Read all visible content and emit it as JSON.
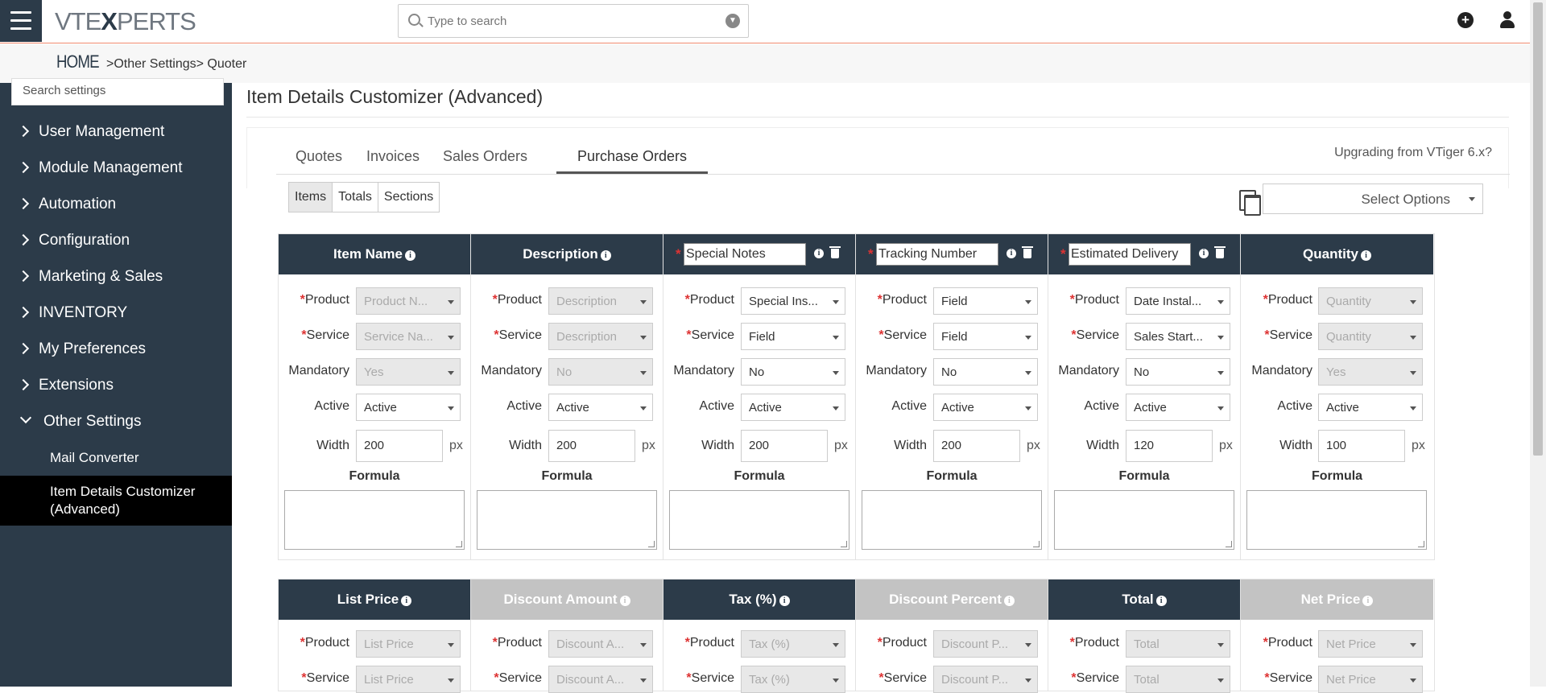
{
  "topbar": {
    "logo_text": "VTEXPERTS",
    "search_placeholder": "Type to search"
  },
  "breadcrumb": {
    "home": "HOME",
    "separator": ">",
    "items": [
      "Other Settings",
      "Quoter"
    ]
  },
  "sidebar": {
    "search_placeholder": "Search settings",
    "items": [
      {
        "label": "User Management"
      },
      {
        "label": "Module Management"
      },
      {
        "label": "Automation"
      },
      {
        "label": "Configuration"
      },
      {
        "label": "Marketing & Sales"
      },
      {
        "label": "INVENTORY"
      },
      {
        "label": "My Preferences"
      },
      {
        "label": "Extensions"
      },
      {
        "label": "Other Settings"
      }
    ],
    "subitems": [
      {
        "label": "Mail Converter"
      },
      {
        "label": "Item Details Customizer\n(Advanced)"
      }
    ]
  },
  "page": {
    "title": "Item Details Customizer (Advanced)",
    "tabs": [
      {
        "label": "Quotes"
      },
      {
        "label": "Invoices"
      },
      {
        "label": "Sales Orders"
      },
      {
        "label": "Purchase Orders"
      }
    ],
    "upgrade_link": "Upgrading from VTiger 6.x?",
    "subtabs": [
      {
        "label": "Items"
      },
      {
        "label": "Totals"
      },
      {
        "label": "Sections"
      }
    ],
    "select_options": "Select Options"
  },
  "labels": {
    "product": "Product",
    "service": "Service",
    "mandatory": "Mandatory",
    "active": "Active",
    "width": "Width",
    "px": "px",
    "formula": "Formula",
    "required_mark": "*",
    "info_mark": "i"
  },
  "columns_row1": [
    {
      "title": "Item Name",
      "editable": false,
      "product": "Product N...",
      "service": "Service Na...",
      "mandatory": "Yes",
      "active": "Active",
      "width": "200"
    },
    {
      "title": "Description",
      "editable": false,
      "product": "Description",
      "service": "Description",
      "mandatory": "No",
      "active": "Active",
      "width": "200"
    },
    {
      "title": "Special Notes",
      "editable": true,
      "product": "Special Ins...",
      "service": "Field",
      "mandatory": "No",
      "active": "Active",
      "width": "200"
    },
    {
      "title": "Tracking Number",
      "editable": true,
      "product": "Field",
      "service": "Field",
      "mandatory": "No",
      "active": "Active",
      "width": "200"
    },
    {
      "title": "Estimated Delivery",
      "editable": true,
      "product": "Date Instal...",
      "service": "Sales Start...",
      "mandatory": "No",
      "active": "Active",
      "width": "120"
    },
    {
      "title": "Quantity",
      "editable": false,
      "product": "Quantity",
      "service": "Quantity",
      "mandatory": "Yes",
      "active": "Active",
      "width": "100"
    }
  ],
  "columns_row2": [
    {
      "title": "List Price",
      "inactive": false,
      "product": "List Price",
      "service": "List Price"
    },
    {
      "title": "Discount Amount",
      "inactive": true,
      "product": "Discount A...",
      "service": "Discount A..."
    },
    {
      "title": "Tax (%)",
      "inactive": false,
      "product": "Tax (%)",
      "service": "Tax (%)"
    },
    {
      "title": "Discount Percent",
      "inactive": true,
      "product": "Discount P...",
      "service": "Discount P..."
    },
    {
      "title": "Total",
      "inactive": false,
      "product": "Total",
      "service": "Total"
    },
    {
      "title": "Net Price",
      "inactive": true,
      "product": "Net Price",
      "service": "Net Price"
    }
  ]
}
